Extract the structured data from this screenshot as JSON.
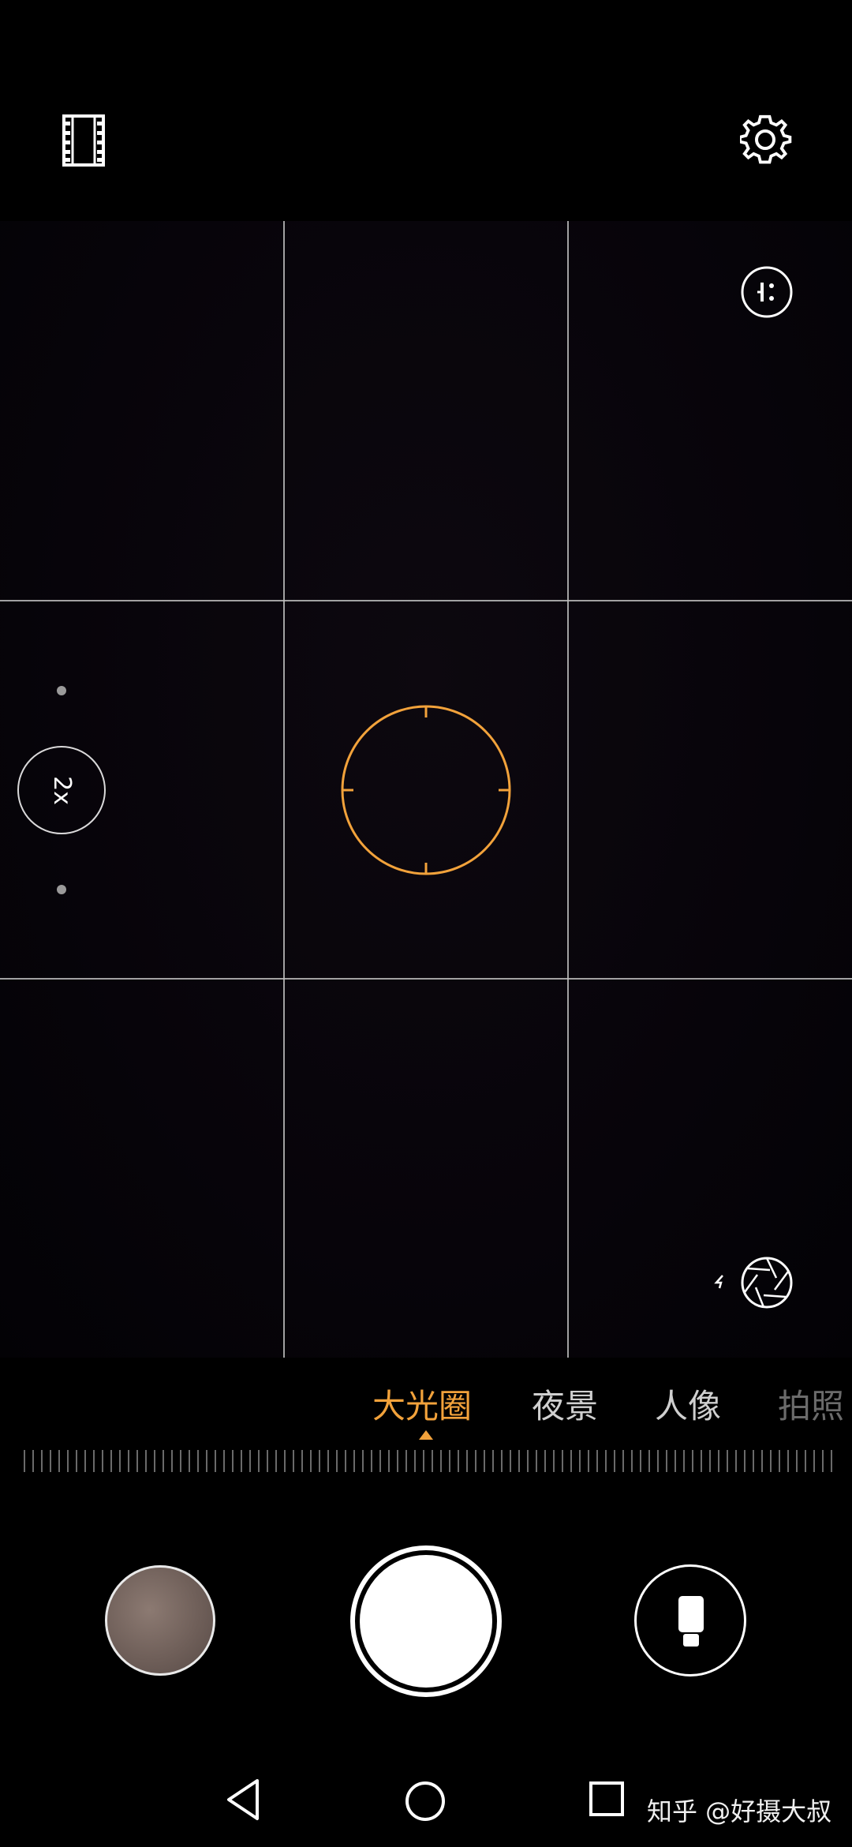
{
  "modes": [
    {
      "label": "大光圈",
      "active": true
    },
    {
      "label": "夜景",
      "active": false
    },
    {
      "label": "人像",
      "active": false
    },
    {
      "label": "拍照",
      "active": false
    }
  ],
  "zoom": {
    "label": "2x"
  },
  "accent_color": "#f2a23b",
  "watermark": "知乎 @好摄大叔",
  "icons": {
    "top_left": "film-strip-icon",
    "top_right": "gear-icon",
    "viewfinder_top_right": "info-icon",
    "viewfinder_bottom_right": "aperture-icon",
    "switch_camera": "switch-camera-icon",
    "nav": [
      "back-icon",
      "home-icon",
      "recents-icon"
    ]
  }
}
